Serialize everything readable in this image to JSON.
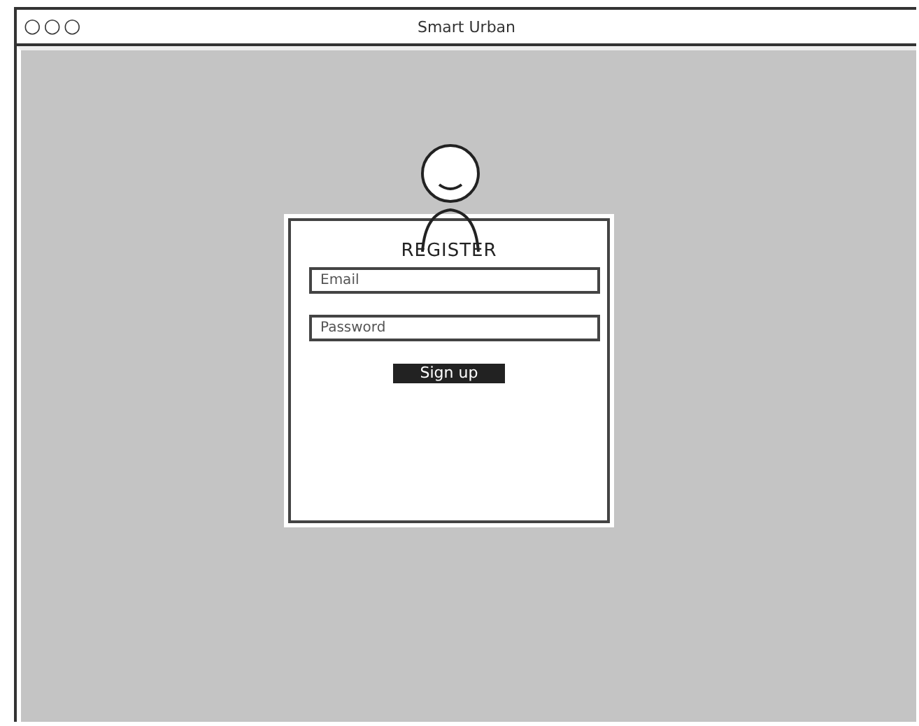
{
  "window": {
    "title": "Smart Urban",
    "controls": [
      "○",
      "○",
      "○"
    ]
  },
  "form": {
    "title": "REGISTER",
    "fields": [
      {
        "placeholder": "Email"
      },
      {
        "placeholder": "Password"
      }
    ],
    "button": "Sign up"
  }
}
